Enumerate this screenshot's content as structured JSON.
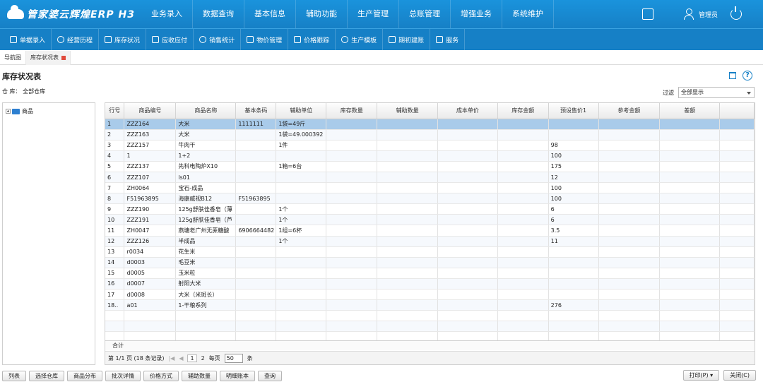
{
  "app": {
    "logo": "管家婆云辉煌ERP H3"
  },
  "main_nav": [
    "业务录入",
    "数据查询",
    "基本信息",
    "辅助功能",
    "生产管理",
    "总账管理",
    "增强业务",
    "系统维护"
  ],
  "user": {
    "name": "管理员"
  },
  "toolbar": [
    "单据录入",
    "经营历程",
    "库存状况",
    "应收应付",
    "销售统计",
    "物价管理",
    "价格跟踪",
    "生产模板",
    "期初建账",
    "服务"
  ],
  "tabs": [
    "导航图",
    "库存状况表"
  ],
  "page": {
    "title": "库存状况表",
    "warehouse": "仓 库：  全部仓库",
    "filter_label": "过滤",
    "filter_value": "全部显示"
  },
  "tree": {
    "root": "商品"
  },
  "columns": [
    "行号",
    "商品编号",
    "商品名称",
    "基本条码",
    "辅助单位",
    "库存数量",
    "辅助数量",
    "成本单价",
    "库存金额",
    "预设售价1",
    "参考金额",
    "差额"
  ],
  "rows": [
    [
      "1",
      "ZZZ164",
      "大米",
      "1111111",
      "1袋=49斤",
      "",
      "",
      "",
      "",
      "",
      "",
      ""
    ],
    [
      "2",
      "ZZZ163",
      "大米",
      "",
      "1袋=49.000392",
      "",
      "",
      "",
      "",
      "",
      "",
      ""
    ],
    [
      "3",
      "ZZZ157",
      "牛肉干",
      "",
      "1件",
      "",
      "",
      "",
      "",
      "98",
      "",
      ""
    ],
    [
      "4",
      "1",
      "1+2",
      "",
      "",
      "",
      "",
      "",
      "",
      "100",
      "",
      ""
    ],
    [
      "5",
      "ZZZ137",
      "先科电陶炉X10",
      "",
      "1箱=6台",
      "",
      "",
      "",
      "",
      "175",
      "",
      ""
    ],
    [
      "6",
      "ZZZ107",
      "ls01",
      "",
      "",
      "",
      "",
      "",
      "",
      "12",
      "",
      ""
    ],
    [
      "7",
      "ZH0064",
      "宝石-成品",
      "",
      "",
      "",
      "",
      "",
      "",
      "100",
      "",
      ""
    ],
    [
      "8",
      "F51963895",
      "海康威视B12",
      "F51963895",
      "",
      "",
      "",
      "",
      "",
      "100",
      "",
      ""
    ],
    [
      "9",
      "ZZZ190",
      "125g舒肤佳香皂（薄",
      "",
      "1个",
      "",
      "",
      "",
      "",
      "6",
      "",
      ""
    ],
    [
      "10",
      "ZZZ191",
      "125g舒肤佳香皂（芦",
      "",
      "1个",
      "",
      "",
      "",
      "",
      "6",
      "",
      ""
    ],
    [
      "11",
      "ZH0047",
      "燕塘老广州无蔗糖酸",
      "6906664482",
      "1组=6杯",
      "",
      "",
      "",
      "",
      "3.5",
      "",
      ""
    ],
    [
      "12",
      "ZZZ126",
      "半成品",
      "",
      "1个",
      "",
      "",
      "",
      "",
      "11",
      "",
      ""
    ],
    [
      "13",
      "r0034",
      "花生米",
      "",
      "",
      "",
      "",
      "",
      "",
      "",
      "",
      ""
    ],
    [
      "14",
      "d0003",
      "毛豆米",
      "",
      "",
      "",
      "",
      "",
      "",
      "",
      "",
      ""
    ],
    [
      "15",
      "d0005",
      "玉米粒",
      "",
      "",
      "",
      "",
      "",
      "",
      "",
      "",
      ""
    ],
    [
      "16",
      "d0007",
      "射阳大米",
      "",
      "",
      "",
      "",
      "",
      "",
      "",
      "",
      ""
    ],
    [
      "17",
      "d0008",
      "大米（米斑长）",
      "",
      "",
      "",
      "",
      "",
      "",
      "",
      "",
      ""
    ],
    [
      "18..",
      "a01",
      "1-干粮系列",
      "",
      "",
      "",
      "",
      "",
      "",
      "276",
      "",
      ""
    ]
  ],
  "sum_label": "合计",
  "pager": {
    "info": "第 1/1 页 (18 条记录)",
    "current": "1",
    "next": "2",
    "per_page_label": "每页",
    "per_page": "50",
    "unit": "条"
  },
  "bottom_buttons": [
    "列表",
    "选择仓库",
    "商品分布",
    "批次详情",
    "价格方式",
    "辅助数量",
    "明细账本",
    "查询"
  ],
  "right_buttons": [
    "打印(P) ▾",
    "关闭(C)"
  ]
}
